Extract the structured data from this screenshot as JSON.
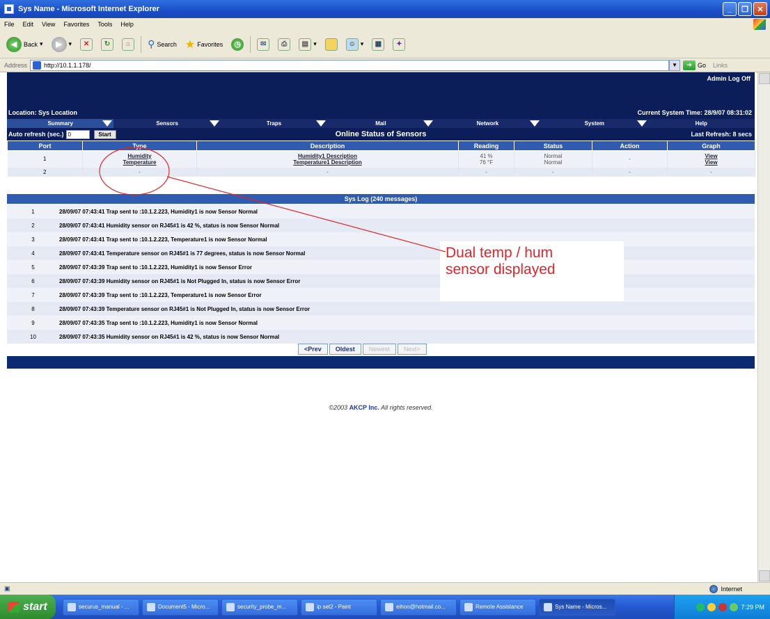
{
  "window": {
    "title": "Sys Name - Microsoft Internet Explorer"
  },
  "menu": [
    "File",
    "Edit",
    "View",
    "Favorites",
    "Tools",
    "Help"
  ],
  "toolbar": {
    "back": "Back",
    "search": "Search",
    "favorites": "Favorites"
  },
  "address": {
    "label": "Address",
    "url": "http://10.1.1.178/",
    "go": "Go",
    "links": "Links"
  },
  "header": {
    "logoff": "Admin Log Off",
    "location": "Location: Sys Location",
    "system_time": "Current System Time: 28/9/07 08:31:02"
  },
  "tabs": [
    "Summary",
    "Sensors",
    "Traps",
    "Mail",
    "Network",
    "System",
    "Help"
  ],
  "refresh": {
    "label": "Auto refresh (sec.)",
    "value": "0",
    "start": "Start",
    "heading": "Online Status of Sensors",
    "last": "Last Refresh: 8 secs"
  },
  "sensor_table": {
    "headers": [
      "Port",
      "Type",
      "Description",
      "Reading",
      "Status",
      "Action",
      "Graph"
    ],
    "rows": [
      {
        "port": "1",
        "type1": "Humidity",
        "type2": "Temperature",
        "desc1": "Humidity1 Description",
        "desc2": "Temperature1 Description",
        "read1": "41 %",
        "read2": "76 °F",
        "status1": "Normal",
        "status2": "Normal",
        "action": "-",
        "graph1": "View",
        "graph2": "View"
      },
      {
        "port": "2",
        "type": "-",
        "desc": "-",
        "read": "-",
        "status": "-",
        "action": "-",
        "graph": "-"
      }
    ]
  },
  "syslog": {
    "title": "Sys Log (240 messages)",
    "entries": [
      {
        "n": "1",
        "text": "28/09/07 07:43:41 Trap sent to :10.1.2.223, Humidity1 is now Sensor Normal"
      },
      {
        "n": "2",
        "text": "28/09/07 07:43:41 Humidity sensor on RJ45#1 is 42 %, status is now Sensor Normal"
      },
      {
        "n": "3",
        "text": "28/09/07 07:43:41 Trap sent to :10.1.2.223, Temperature1 is now Sensor Normal"
      },
      {
        "n": "4",
        "text": "28/09/07 07:43:41 Temperature sensor on RJ45#1 is 77 degrees, status is now Sensor Normal"
      },
      {
        "n": "5",
        "text": "28/09/07 07:43:39 Trap sent to :10.1.2.223, Humidity1 is now Sensor Error"
      },
      {
        "n": "6",
        "text": "28/09/07 07:43:39 Humidity sensor on RJ45#1 is Not Plugged In, status is now Sensor Error"
      },
      {
        "n": "7",
        "text": "28/09/07 07:43:39 Trap sent to :10.1.2.223, Temperature1 is now Sensor Error"
      },
      {
        "n": "8",
        "text": "28/09/07 07:43:39 Temperature sensor on RJ45#1 is Not Plugged In, status is now Sensor Error"
      },
      {
        "n": "9",
        "text": "28/09/07 07:43:35 Trap sent to :10.1.2.223, Humidity1 is now Sensor Normal"
      },
      {
        "n": "10",
        "text": "28/09/07 07:43:35 Humidity sensor on RJ45#1 is 42 %, status is now Sensor Normal"
      }
    ]
  },
  "pager": {
    "prev": "<Prev",
    "oldest": "Oldest",
    "newest": "Newest",
    "next": "Next>"
  },
  "footer": {
    "copyright_pre": "©2003",
    "brand": "AKCP Inc.",
    "copyright_post": "All rights reserved."
  },
  "annotation": {
    "line1": "Dual temp / hum",
    "line2": "sensor displayed",
    "color": "#e0242a"
  },
  "statusbar": {
    "zone": "Internet"
  },
  "taskbar": {
    "start": "start",
    "items": [
      "securus_manual - ...",
      "Document5 - Micro...",
      "security_probe_m...",
      "ip set2 - Paint",
      "eihoo@hotmail.co...",
      "Remote Assistance",
      "Sys Name - Micros..."
    ],
    "clock": "7:29 PM"
  }
}
